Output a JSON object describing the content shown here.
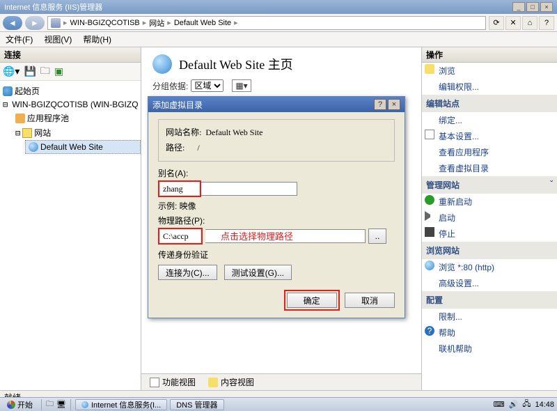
{
  "window_title": "Internet 信息服务 (IIS)管理器",
  "breadcrumb": {
    "b1": "WIN-BGIZQCOTISB",
    "b2": "网站",
    "b3": "Default Web Site"
  },
  "menu": {
    "file": "文件(F)",
    "view": "视图(V)",
    "help": "帮助(H)"
  },
  "left": {
    "header": "连接",
    "start_page": "起始页",
    "server": "WIN-BGIZQCOTISB (WIN-BGIZQ",
    "app_pools": "应用程序池",
    "sites": "网站",
    "site1": "Default Web Site"
  },
  "center": {
    "title": "Default Web Site 主页",
    "group_label": "分组依据:",
    "group_value": "区域",
    "tab1": "功能视图",
    "tab2": "内容视图"
  },
  "right": {
    "header": "操作",
    "browse": "浏览",
    "edit_perm": "编辑权限...",
    "edit_site": "编辑站点",
    "bindings": "绑定...",
    "basic_settings": "基本设置...",
    "view_apps": "查看应用程序",
    "view_vdirs": "查看虚拟目录",
    "manage_site": "管理网站",
    "restart": "重新启动",
    "start": "启动",
    "stop": "停止",
    "browse_site": "浏览网站",
    "browse_80": "浏览 *:80 (http)",
    "adv_settings": "高级设置...",
    "config": "配置",
    "limits": "限制...",
    "help_hdr": "帮助",
    "online_help": "联机帮助"
  },
  "dialog": {
    "title": "添加虚拟目录",
    "site_name_label": "网站名称:",
    "site_name": "Default Web Site",
    "path_label": "路径:",
    "path": "/",
    "alias_label": "别名(A):",
    "alias_value": "zhang",
    "example": "示例: 映像",
    "phys_label": "物理路径(P):",
    "phys_value": "C:\\accp",
    "phys_hint": "点击选择物理路径",
    "passthrough": "传递身份验证",
    "connect_as": "连接为(C)...",
    "test_settings": "测试设置(G)...",
    "ok": "确定",
    "cancel": "取消"
  },
  "status": "就绪",
  "taskbar": {
    "start": "开始",
    "task1": "Internet 信息服务(I...",
    "task2": "DNS 管理器",
    "time": "14:48"
  }
}
